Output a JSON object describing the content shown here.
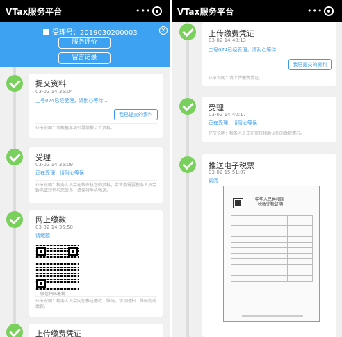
{
  "left": {
    "app_title": "VTax服务平台",
    "menu_dots": "•••",
    "header": {
      "accept_no": "受理号：2019030200003",
      "close": "×",
      "btn_rate": "服务评价",
      "btn_msg": "留言记录"
    },
    "steps": [
      {
        "title": "提交资料",
        "time": "03-02 14:35:04",
        "status": "工号074已经受理，请耐心等待...",
        "button": "我已提交的资料",
        "note": "环节说明：请根据事项引导填报以上资料。"
      },
      {
        "title": "受理",
        "time": "03-02 14:35:09",
        "status": "正在受理，请耐心等候...",
        "note": "环节说明：税务人员会在线审核您的资料，若业务需要税务人员会致电或短信与您联系，请保持手机畅通。"
      },
      {
        "title": "网上缴款",
        "time": "03-02 14:36:50",
        "status": "请缴款",
        "qr_caption": "微信扫码缴税",
        "note": "环节说明：税务人员会向你推送缴款二维码，请及时扫二维码完成缴款。"
      },
      {
        "title": "上传缴费凭证"
      }
    ]
  },
  "right": {
    "app_title": "VTax服务平台",
    "menu_dots": "•••",
    "steps": [
      {
        "title": "上传缴费凭证",
        "time": "03-02 14:40:13",
        "status": "工号074已经受理，请耐心等待...",
        "button": "我已提交的资料",
        "note": "环节说明：请上传缴费凭证。"
      },
      {
        "title": "受理",
        "time": "03-02 14:40:17",
        "status": "正在受理，请耐心等候...",
        "note": "环节说明：税务人员正在审核和确认你的缴款情况。"
      },
      {
        "title": "推送电子税票",
        "time": "03-02 15:51:07",
        "status": "调阅",
        "doc_h1": "中华人民共和国",
        "doc_h2": "税收完税证明"
      }
    ]
  },
  "colors": {
    "accent": "#3ea2f2",
    "success": "#79d05c",
    "link": "#3a9ae8"
  }
}
